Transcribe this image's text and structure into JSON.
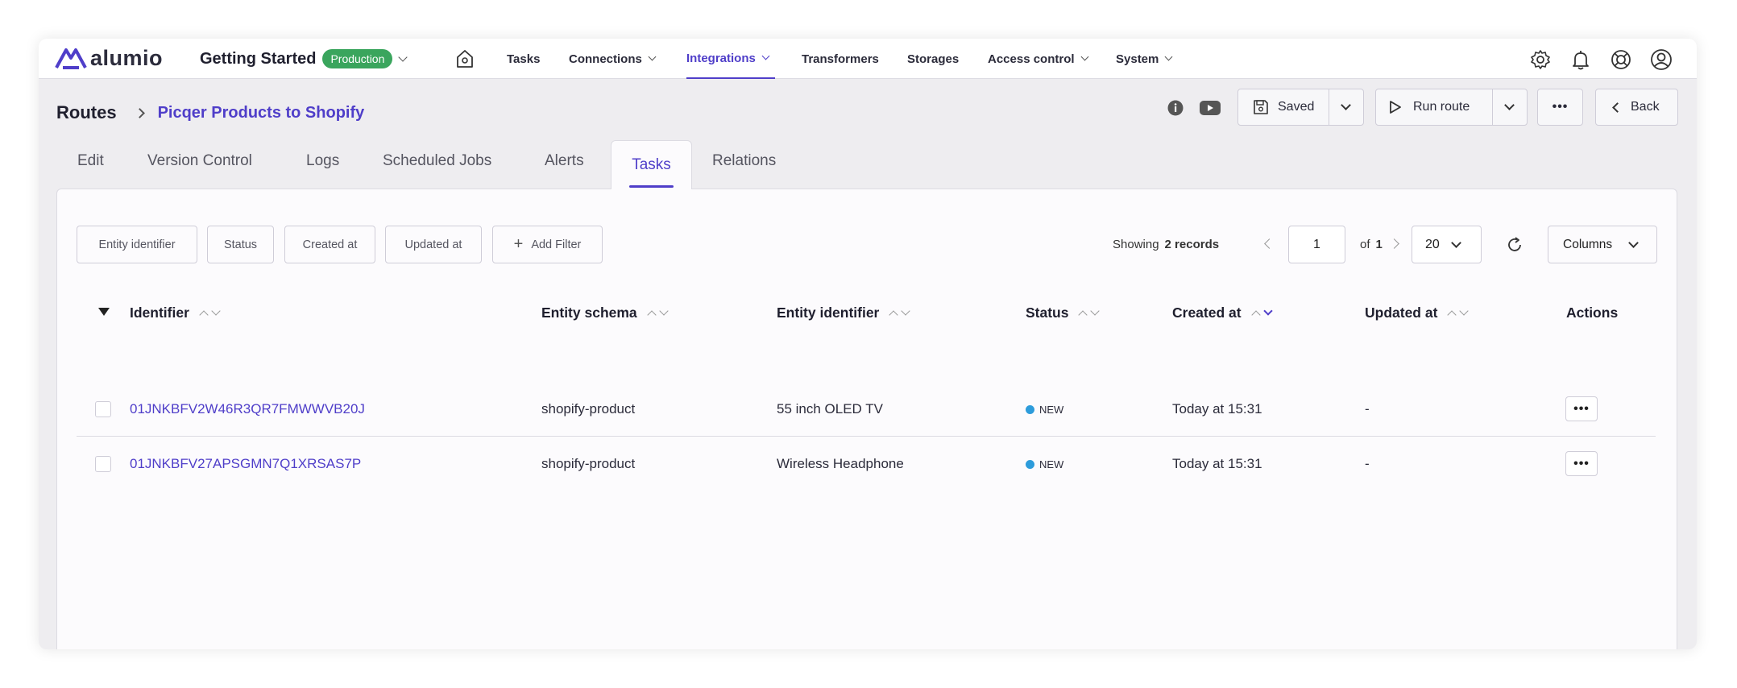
{
  "app": {
    "logo_text": "alumio",
    "project_title": "Getting Started",
    "environment_badge": "Production",
    "brand_color": "#4f3ec9",
    "badge_color": "#3aa55d"
  },
  "nav": {
    "items": [
      {
        "label": "Tasks",
        "has_dropdown": false,
        "active": false
      },
      {
        "label": "Connections",
        "has_dropdown": true,
        "active": false
      },
      {
        "label": "Integrations",
        "has_dropdown": true,
        "active": true
      },
      {
        "label": "Transformers",
        "has_dropdown": false,
        "active": false
      },
      {
        "label": "Storages",
        "has_dropdown": false,
        "active": false
      },
      {
        "label": "Access control",
        "has_dropdown": true,
        "active": false
      },
      {
        "label": "System",
        "has_dropdown": true,
        "active": false
      }
    ],
    "right_icons": [
      "gear-icon",
      "bell-icon",
      "lifebuoy-icon",
      "user-icon"
    ]
  },
  "breadcrumb": {
    "root": "Routes",
    "current": "Picqer Products to Shopify"
  },
  "header_actions": {
    "saved_label": "Saved",
    "run_route_label": "Run route",
    "more_label": "•••",
    "back_label": "Back"
  },
  "tabs": [
    {
      "label": "Edit",
      "active": false
    },
    {
      "label": "Version Control",
      "active": false
    },
    {
      "label": "Logs",
      "active": false
    },
    {
      "label": "Scheduled Jobs",
      "active": false
    },
    {
      "label": "Alerts",
      "active": false
    },
    {
      "label": "Tasks",
      "active": true
    },
    {
      "label": "Relations",
      "active": false
    }
  ],
  "filters": {
    "items": [
      "Entity identifier",
      "Status",
      "Created at",
      "Updated at"
    ],
    "add_filter_label": "Add Filter"
  },
  "pagination": {
    "showing_label": "Showing",
    "records_text": "2 records",
    "page": "1",
    "of_label": "of",
    "total_pages": "1",
    "page_size": "20",
    "columns_label": "Columns"
  },
  "table": {
    "columns": [
      "Identifier",
      "Entity schema",
      "Entity identifier",
      "Status",
      "Created at",
      "Updated at",
      "Actions"
    ],
    "sorted_column": "Created at",
    "rows": [
      {
        "identifier": "01JNKBFV2W46R3QR7FMWWVB20J",
        "entity_schema": "shopify-product",
        "entity_identifier": "55 inch OLED TV",
        "status": "NEW",
        "created_at": "Today at 15:31",
        "updated_at": "-",
        "actions": "•••"
      },
      {
        "identifier": "01JNKBFV27APSGMN7Q1XRSAS7P",
        "entity_schema": "shopify-product",
        "entity_identifier": "Wireless Headphone",
        "status": "NEW",
        "created_at": "Today at 15:31",
        "updated_at": "-",
        "actions": "•••"
      }
    ]
  }
}
